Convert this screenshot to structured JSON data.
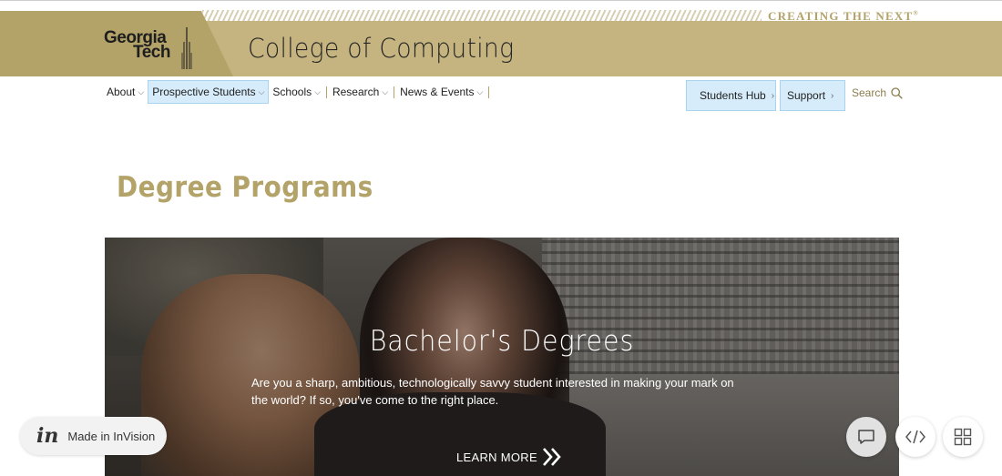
{
  "header": {
    "tagline": "CREATING THE NEXT",
    "tagline_mark": "®",
    "logo_line1": "Georgia",
    "logo_line2": "Tech",
    "college": "College of Computing"
  },
  "nav": {
    "items": [
      {
        "label": "About"
      },
      {
        "label": "Prospective Students"
      },
      {
        "label": "Schools"
      },
      {
        "label": "Research"
      },
      {
        "label": "News & Events"
      }
    ],
    "students_hub": "Students Hub",
    "support": "Support",
    "search": "Search"
  },
  "main": {
    "heading": "Degree Programs",
    "hero": {
      "title": "Bachelor's Degrees",
      "text": "Are you a sharp, ambitious, technologically savvy student interested in making your mark on the world? If so, you've come to the right place.",
      "cta": "LEARN MORE"
    }
  },
  "invision": {
    "logo": "in",
    "label": "Made in InVision"
  },
  "toolbar_icons": [
    "comment-icon",
    "code-icon",
    "grid-icon"
  ],
  "colors": {
    "gold": "#b3a369",
    "gold_light": "#c5b47f",
    "highlight": "#d6ecfb"
  }
}
